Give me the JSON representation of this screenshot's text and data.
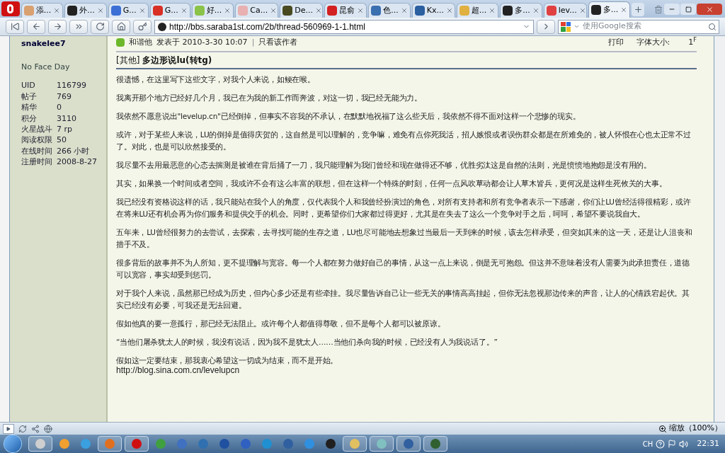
{
  "tabs": [
    {
      "label": "添...",
      "color": "#d9a070",
      "selected": false
    },
    {
      "label": "外...",
      "color": "#222222",
      "selected": false
    },
    {
      "label": "G...",
      "color": "#3b6fd6",
      "selected": false
    },
    {
      "label": "G...",
      "color": "#d93025",
      "selected": false
    },
    {
      "label": "好...",
      "color": "#8bc34a",
      "selected": false
    },
    {
      "label": "Ca...",
      "color": "#e8b0b0",
      "selected": false
    },
    {
      "label": "De...",
      "color": "#4a4a20",
      "selected": false
    },
    {
      "label": "昆俞",
      "color": "#d32020",
      "selected": false
    },
    {
      "label": "色...",
      "color": "#3a6fb0",
      "selected": false
    },
    {
      "label": "Kx...",
      "color": "#2a5fa0",
      "selected": false
    },
    {
      "label": "超...",
      "color": "#e0b040",
      "selected": false
    },
    {
      "label": "多...",
      "color": "#222222",
      "selected": false
    },
    {
      "label": "lev...",
      "color": "#e04040",
      "selected": false
    },
    {
      "label": "多...",
      "color": "#222222",
      "selected": true
    }
  ],
  "address": {
    "url": "http://bbs.saraba1st.com/2b/thread-560969-1-1.html"
  },
  "search": {
    "placeholder": "使用Google搜索"
  },
  "profile": {
    "username": "snakelee7",
    "title": "No Face Day",
    "stats": [
      {
        "label": "UID",
        "value": "116799"
      },
      {
        "label": "帖子",
        "value": "769"
      },
      {
        "label": "精华",
        "value": "0"
      },
      {
        "label": "积分",
        "value": "3110"
      },
      {
        "label": "火星战斗",
        "value": "7 rp"
      },
      {
        "label": "阅读权限",
        "value": "50"
      },
      {
        "label": "在线时间",
        "value": "266 小时"
      },
      {
        "label": "注册时间",
        "value": "2008-8-27"
      }
    ]
  },
  "post": {
    "author": "和谐他",
    "posted": "发表于 2010-3-30 10:07",
    "separator": "|",
    "author_only": "只看该作者",
    "print": "打印",
    "font_size": "字体大小:",
    "floor": "1",
    "floor_mark": "F",
    "category": "[其他]",
    "title": "多边形说lu(转tg)",
    "paragraphs": [
      "很遗憾，在这里写下这些文字，对我个人来说，如鲠在喉。",
      "我离开那个地方已经好几个月，我已在为我的新工作而奔波，对这一切，我已经无能为力。",
      "我依然不愿意说出\"levelup.cn\"已经倒掉，但事实不容我的不承认，在默默地祝福了这么些天后，我依然不得不面对这样一个悲惨的现实。",
      "或许，对于某些人来说，LU的倒掉是值得庆贺的，这自然是可以理解的，竞争嘛，难免有点你死我活，招人嫉恨或者误伤群众都是在所难免的，被人怀恨在心也太正常不过了。对此，也是可以欣然接受的。",
      "我尽量不去用最恶意的心态去揣测是被谁在背后捅了一刀，我只能理解为我们曾经和现在做得还不够，优胜劣汰这是自然的法则，光是愤愤地抱怨是没有用的。",
      "其实，如果换一个时间或者空间，我或许不会有这么丰富的联想，但在这样一个特殊的时刻，任何一点风吹草动都会让人草木皆兵，更何况是这样生死攸关的大事。",
      "我已经没有资格说这样的话，我只能站在我个人的角度，仅代表我个人和我曾经扮演过的角色，对所有支持者和所有竞争者表示一下感谢，你们让LU曾经活得很精彩，或许在将来LU还有机会再为你们服务和提供交手的机会。同时，更希望你们大家都过得更好，尤其是在失去了这么一个竞争对手之后，呵呵，希望不要说我自大。",
      "五年来，LU曾经很努力的去尝试，去探索，去寻找可能的生存之道，LU也尽可能地去想象过当最后一天到来的时候，该去怎样承受，但突如其来的这一天，还是让人沮丧和措手不及。",
      "很多背后的故事并不为人所知，更不提理解与宽容。每一个人都在努力做好自己的事情，从这一点上来说，倒是无可抱怨。但这并不意味着没有人需要为此承担责任，道德可以宽容，事实却受到惩罚。",
      "对于我个人来说，虽然那已经成为历史，但内心多少还是有些牵挂。我尽量告诉自己让一些无关的事情高高挂起，但你无法忽视那边传来的声音，让人的心情跌宕起伏。其实已经没有必要，可我还是无法回避。",
      "假如他真的要一意孤行，那已经无法阻止。或许每个人都值得尊敬，但不是每个人都可以被原谅。",
      "“当他们屠杀犹太人的时候，我没有说话，因为我不是犹太人……当他们杀向我的时候，已经没有人为我说话了。”",
      "假如这一定要结束，那我衷心希望这一切成为结束，而不是开始。"
    ],
    "link": "http://blog.sina.com.cn/levelupcn"
  },
  "status_bar": {
    "zoom": "缩放（100%）"
  },
  "taskbar": {
    "apps": [
      {
        "color": "#cfcfcf",
        "selected": true
      },
      {
        "color": "#f0a030",
        "selected": false
      },
      {
        "color": "#3aa0e0",
        "selected": false
      },
      {
        "color": "#e07020",
        "selected": true
      },
      {
        "color": "#d01010",
        "selected": true
      },
      {
        "color": "#40a040",
        "selected": false
      },
      {
        "color": "#4070c0",
        "selected": false
      },
      {
        "color": "#3070b0",
        "selected": false
      },
      {
        "color": "#2050a0",
        "selected": false
      },
      {
        "color": "#3060c0",
        "selected": false
      },
      {
        "color": "#2090d0",
        "selected": false
      },
      {
        "color": "#3060a0",
        "selected": false
      },
      {
        "color": "#3090e0",
        "selected": false
      },
      {
        "color": "#202020",
        "selected": false
      },
      {
        "color": "#e0c060",
        "selected": true
      },
      {
        "color": "#80c0c0",
        "selected": true
      },
      {
        "color": "#3060a0",
        "selected": true
      },
      {
        "color": "#306030",
        "selected": true
      }
    ],
    "language": "CH",
    "time": "22:31"
  }
}
